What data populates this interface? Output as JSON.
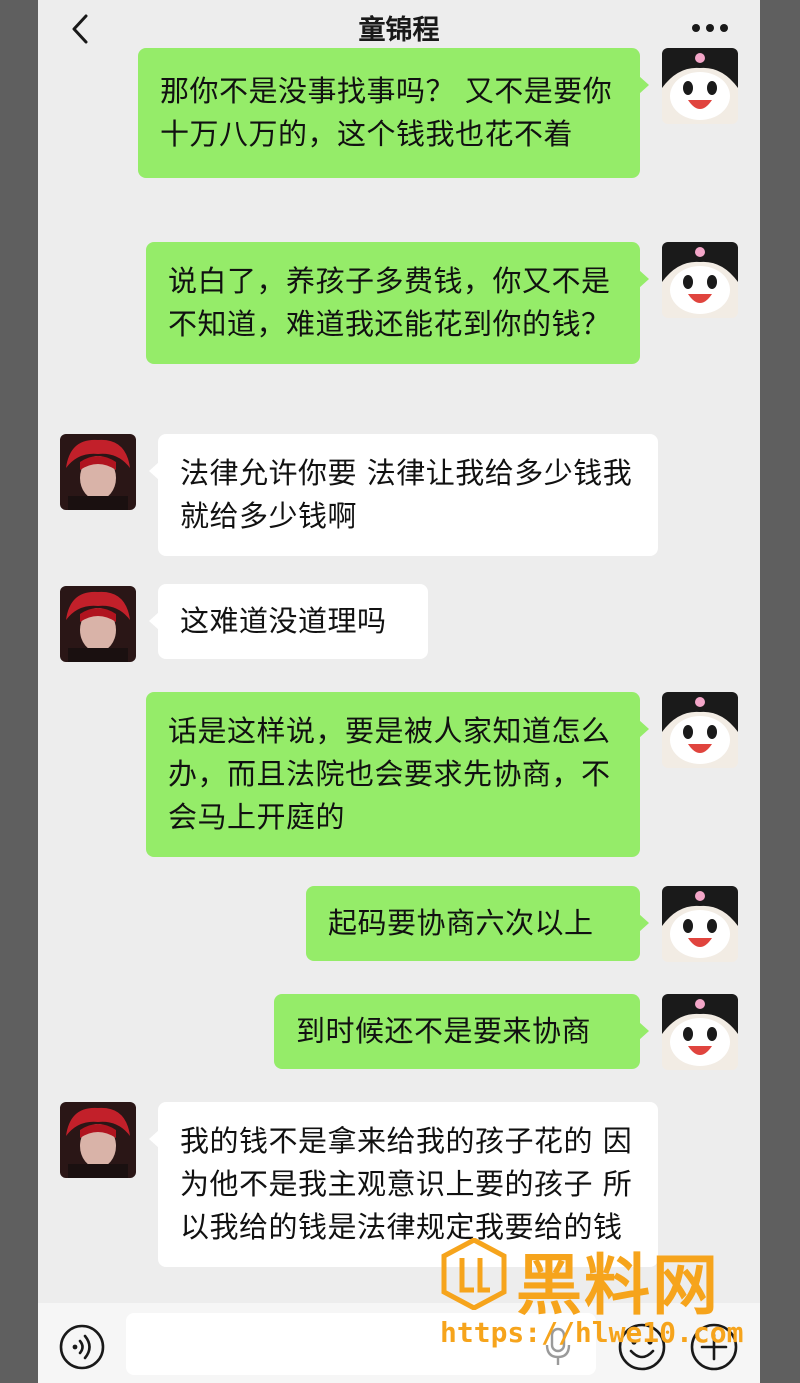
{
  "header": {
    "title": "童锦程",
    "back_icon": "chevron-left-icon",
    "more_icon": "more-dots-icon"
  },
  "messages": [
    {
      "side": "right",
      "text": "那你不是没事找事吗？ 又不是要你十万八万的，这个钱我也花不着"
    },
    {
      "side": "right",
      "text": "说白了，养孩子多费钱，你又不是不知道，难道我还能花到你的钱？"
    },
    {
      "side": "left",
      "text": "法律允许你要 法律让我给多少钱我就给多少钱啊"
    },
    {
      "side": "left",
      "text": "这难道没道理吗"
    },
    {
      "side": "right",
      "text": "话是这样说，要是被人家知道怎么办，而且法院也会要求先协商，不会马上开庭的"
    },
    {
      "side": "right",
      "text": "起码要协商六次以上"
    },
    {
      "side": "right",
      "text": "到时候还不是要来协商"
    },
    {
      "side": "left",
      "text": "我的钱不是拿来给我的孩子花的 因为他不是我主观意识上要的孩子 所以我给的钱是法律规定我要给的钱"
    }
  ],
  "input_bar": {
    "voice_icon": "voice-icon",
    "emoji_icon": "emoji-icon",
    "plus_icon": "plus-icon"
  },
  "watermark": {
    "name": "黑料网",
    "url": "https://hlwe10.com"
  },
  "colors": {
    "self_bubble": "#95ec69",
    "other_bubble": "#ffffff",
    "background": "#ededed",
    "watermark": "#f6a41c"
  }
}
